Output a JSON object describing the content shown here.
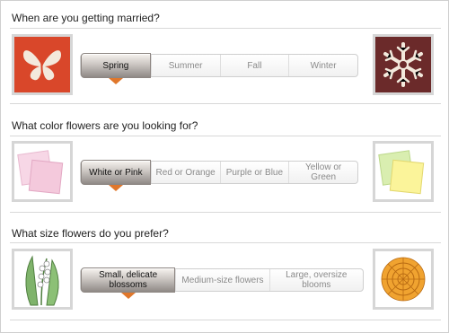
{
  "questions": [
    {
      "title": "When are you getting married?",
      "options": [
        "Spring",
        "Summer",
        "Fall",
        "Winter"
      ],
      "selected_index": 0,
      "left_icon": "butterfly-icon",
      "right_icon": "snowflake-icon"
    },
    {
      "title": "What color flowers are you looking for?",
      "options": [
        "White or Pink",
        "Red or Orange",
        "Purple or Blue",
        "Yellow or Green"
      ],
      "selected_index": 0,
      "left_icon": "pink-swatches-icon",
      "right_icon": "yellow-green-swatches-icon"
    },
    {
      "title": "What size flowers do you prefer?",
      "options": [
        "Small, delicate blossoms",
        "Medium-size flowers",
        "Large, oversize blooms"
      ],
      "selected_index": 0,
      "left_icon": "lily-of-the-valley-icon",
      "right_icon": "dahlia-icon"
    }
  ],
  "colors": {
    "accent_arrow": "#e0772b",
    "butterfly_bg": "#d9472a",
    "snowflake_bg": "#6b2a2a"
  }
}
